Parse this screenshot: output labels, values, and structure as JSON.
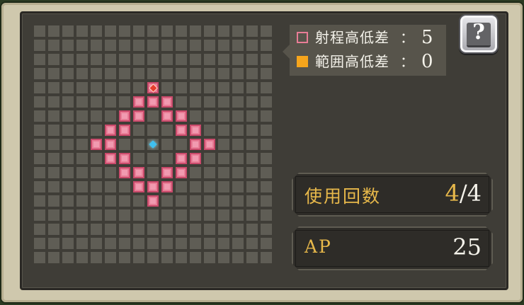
{
  "legend": {
    "range_height": {
      "label": "射程高低差",
      "colon": "：",
      "value": "5",
      "color": "#e87d96"
    },
    "area_height": {
      "label": "範囲高低差",
      "colon": "：",
      "value": "0",
      "color": "#f6a51c"
    }
  },
  "help": {
    "label": "?"
  },
  "uses": {
    "label": "使用回数",
    "current": "4",
    "separator": "/",
    "max": "4"
  },
  "ap": {
    "label": "AP",
    "value": "25"
  },
  "grid": {
    "columns": 17,
    "rows": 17,
    "center": [
      8,
      8
    ],
    "target": [
      8,
      4
    ],
    "range_cells": [
      [
        8,
        4
      ],
      [
        7,
        5
      ],
      [
        8,
        5
      ],
      [
        9,
        5
      ],
      [
        6,
        6
      ],
      [
        7,
        6
      ],
      [
        9,
        6
      ],
      [
        10,
        6
      ],
      [
        5,
        7
      ],
      [
        6,
        7
      ],
      [
        10,
        7
      ],
      [
        11,
        7
      ],
      [
        4,
        8
      ],
      [
        5,
        8
      ],
      [
        11,
        8
      ],
      [
        12,
        8
      ],
      [
        5,
        9
      ],
      [
        6,
        9
      ],
      [
        10,
        9
      ],
      [
        11,
        9
      ],
      [
        6,
        10
      ],
      [
        7,
        10
      ],
      [
        9,
        10
      ],
      [
        10,
        10
      ],
      [
        7,
        11
      ],
      [
        8,
        11
      ],
      [
        9,
        11
      ],
      [
        8,
        12
      ]
    ]
  }
}
